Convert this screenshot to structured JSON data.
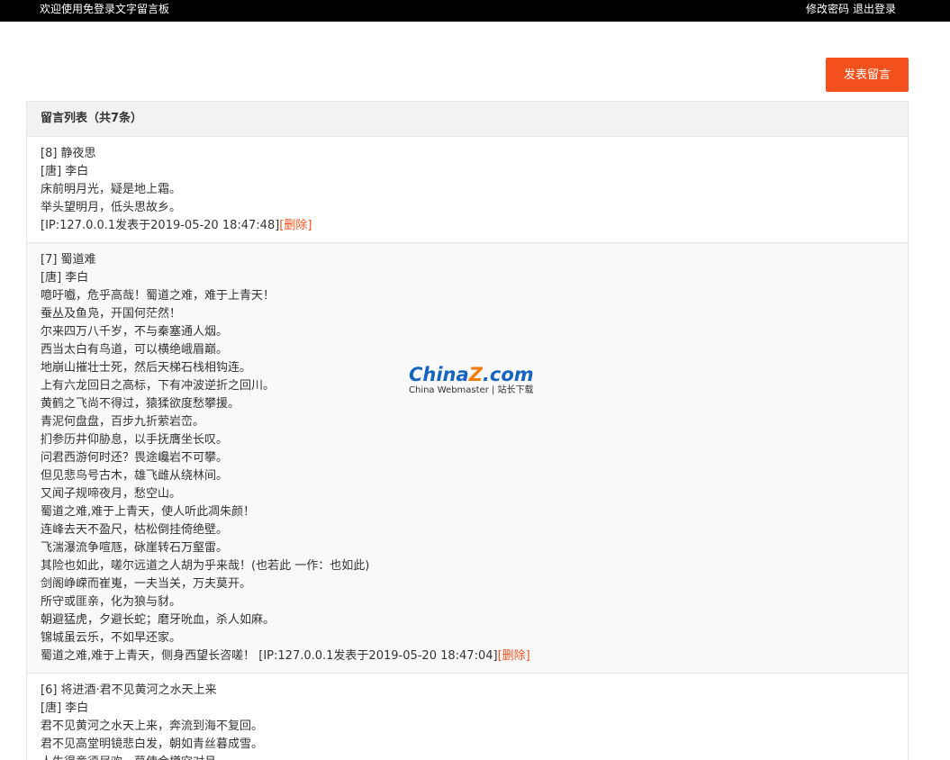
{
  "topbar": {
    "title": "欢迎使用免登录文字留言板",
    "change_password": "修改密码",
    "logout": "退出登录"
  },
  "post_button": "发表留言",
  "list": {
    "header": "留言列表（共7条）",
    "delete_label": "[删除]",
    "messages": [
      {
        "title": "[8] 静夜思",
        "author": "[唐] 李白",
        "lines": [
          "床前明月光，疑是地上霜。",
          "举头望明月，低头思故乡。"
        ],
        "meta_prefix": "",
        "meta": " [IP:127.0.0.1发表于2019-05-20 18:47:48]"
      },
      {
        "title": "[7] 蜀道难",
        "author": "[唐] 李白",
        "lines": [
          "噫吁嚱，危乎高哉！蜀道之难，难于上青天！",
          "蚕丛及鱼凫，开国何茫然！",
          "尔来四万八千岁，不与秦塞通人烟。",
          "西当太白有鸟道，可以横绝峨眉巅。",
          "地崩山摧壮士死，然后天梯石栈相钩连。",
          "上有六龙回日之高标，下有冲波逆折之回川。",
          "黄鹤之飞尚不得过，猿猱欲度愁攀援。",
          "青泥何盘盘，百步九折萦岩峦。",
          "扪参历井仰胁息，以手抚膺坐长叹。",
          "问君西游何时还？畏途巉岩不可攀。",
          "但见悲鸟号古木，雄飞雌从绕林间。",
          "又闻子规啼夜月，愁空山。",
          "蜀道之难,难于上青天，使人听此凋朱颜！",
          "连峰去天不盈尺，枯松倒挂倚绝壁。",
          "飞湍瀑流争喧豗，砯崖转石万壑雷。",
          "其险也如此，嗟尔远道之人胡为乎来哉！(也若此 一作：也如此)",
          "剑阁峥嵘而崔嵬，一夫当关，万夫莫开。",
          "所守或匪亲，化为狼与豺。",
          "朝避猛虎，夕避长蛇；磨牙吮血，杀人如麻。",
          "锦城虽云乐，不如早还家。"
        ],
        "meta_prefix": "蜀道之难,难于上青天，侧身西望长咨嗟！",
        "meta": " [IP:127.0.0.1发表于2019-05-20 18:47:04]"
      },
      {
        "title": "[6] 将进酒·君不见黄河之水天上来",
        "author": "[唐] 李白",
        "lines": [
          "君不见黄河之水天上来，奔流到海不复回。",
          "君不见高堂明镜悲白发，朝如青丝暮成雪。",
          "人生得意须尽欢，莫使金樽空对月。"
        ],
        "meta_prefix": "",
        "meta": ""
      }
    ]
  },
  "watermark": {
    "logo_prefix": "China",
    "logo_z": "Z",
    "logo_suffix": ".com",
    "subtitle": "China Webmaster | 站长下载"
  },
  "colors": {
    "accent": "#f4511e",
    "topbar_bg": "#000000",
    "header_bg": "#f2f2f2",
    "alt_row_bg": "#f9f9f9"
  }
}
